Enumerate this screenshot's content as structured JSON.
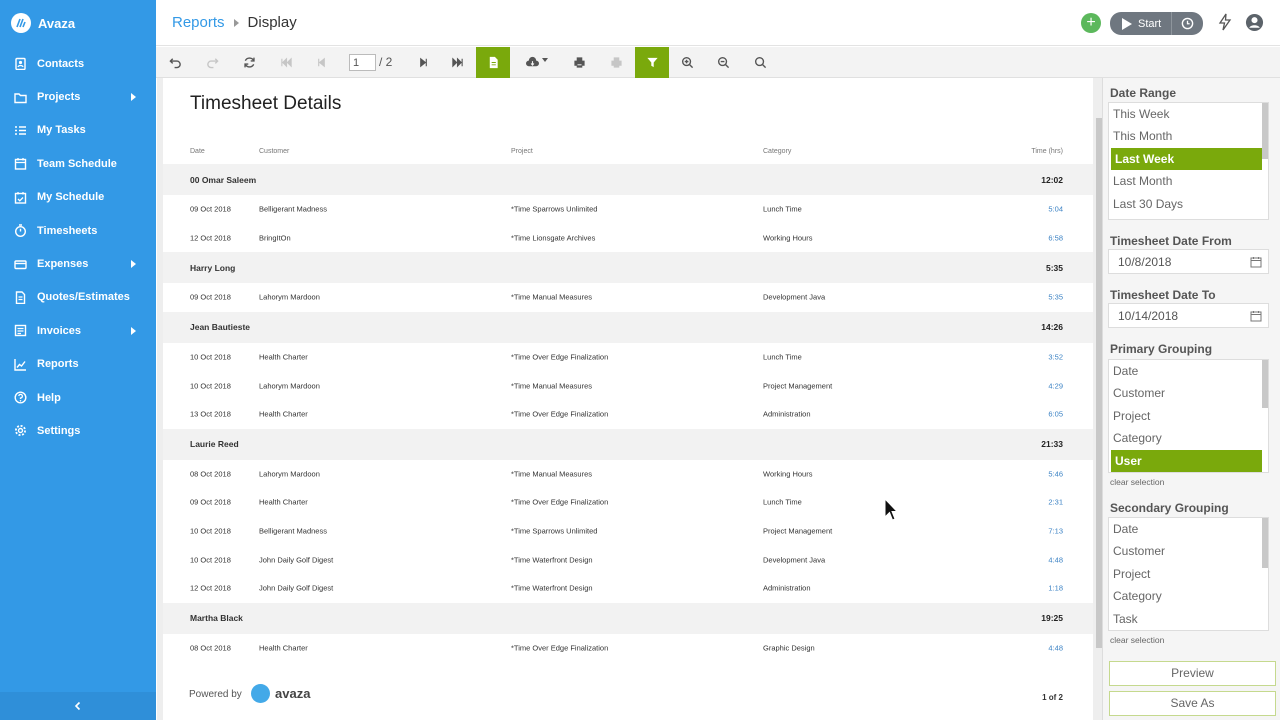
{
  "app": {
    "name": "Avaza"
  },
  "sidebar": {
    "items": [
      {
        "label": "Contacts",
        "icon": "contacts-icon",
        "submenu": false
      },
      {
        "label": "Projects",
        "icon": "folder-icon",
        "submenu": true
      },
      {
        "label": "My Tasks",
        "icon": "tasks-icon",
        "submenu": false
      },
      {
        "label": "Team Schedule",
        "icon": "calendar-icon",
        "submenu": false
      },
      {
        "label": "My Schedule",
        "icon": "calendar-check-icon",
        "submenu": false
      },
      {
        "label": "Timesheets",
        "icon": "stopwatch-icon",
        "submenu": false
      },
      {
        "label": "Expenses",
        "icon": "card-icon",
        "submenu": true
      },
      {
        "label": "Quotes/Estimates",
        "icon": "document-icon",
        "submenu": false
      },
      {
        "label": "Invoices",
        "icon": "invoice-icon",
        "submenu": true
      },
      {
        "label": "Reports",
        "icon": "chart-icon",
        "submenu": false
      },
      {
        "label": "Help",
        "icon": "help-icon",
        "submenu": false
      },
      {
        "label": "Settings",
        "icon": "gear-icon",
        "submenu": false
      }
    ]
  },
  "header": {
    "breadcrumb_parent": "Reports",
    "breadcrumb_current": "Display",
    "start_label": "Start",
    "add_label": "+"
  },
  "toolbar": {
    "page_current": "1",
    "page_total": "/ 2"
  },
  "report": {
    "title": "Timesheet Details",
    "columns": {
      "date": "Date",
      "customer": "Customer",
      "project": "Project",
      "category": "Category",
      "time": "Time (hrs)"
    },
    "groups": [
      {
        "name": "00 Omar Saleem",
        "total": "12:02",
        "rows": [
          {
            "date": "09 Oct 2018",
            "customer": "Belligerant Madness",
            "project": "*Time Sparrows Unlimited",
            "category": "Lunch Time",
            "time": "5:04"
          },
          {
            "date": "12 Oct 2018",
            "customer": "BringItOn",
            "project": "*Time Lionsgate Archives",
            "category": "Working Hours",
            "time": "6:58"
          }
        ]
      },
      {
        "name": "Harry Long",
        "total": "5:35",
        "rows": [
          {
            "date": "09 Oct 2018",
            "customer": "Lahorym Mardoon",
            "project": "*Time Manual Measures",
            "category": "Development Java",
            "time": "5:35"
          }
        ]
      },
      {
        "name": "Jean Bautieste",
        "total": "14:26",
        "rows": [
          {
            "date": "10 Oct 2018",
            "customer": "Health Charter",
            "project": "*Time Over Edge Finalization",
            "category": "Lunch Time",
            "time": "3:52"
          },
          {
            "date": "10 Oct 2018",
            "customer": "Lahorym Mardoon",
            "project": "*Time Manual Measures",
            "category": "Project Management",
            "time": "4:29"
          },
          {
            "date": "13 Oct 2018",
            "customer": "Health Charter",
            "project": "*Time Over Edge Finalization",
            "category": "Administration",
            "time": "6:05"
          }
        ]
      },
      {
        "name": "Laurie Reed",
        "total": "21:33",
        "rows": [
          {
            "date": "08 Oct 2018",
            "customer": "Lahorym Mardoon",
            "project": "*Time Manual Measures",
            "category": "Working Hours",
            "time": "5:46"
          },
          {
            "date": "09 Oct 2018",
            "customer": "Health Charter",
            "project": "*Time Over Edge Finalization",
            "category": "Lunch Time",
            "time": "2:31"
          },
          {
            "date": "10 Oct 2018",
            "customer": "Belligerant Madness",
            "project": "*Time Sparrows Unlimited",
            "category": "Project Management",
            "time": "7:13"
          },
          {
            "date": "10 Oct 2018",
            "customer": "John Daily Golf Digest",
            "project": "*Time Waterfront Design",
            "category": "Development Java",
            "time": "4:48"
          },
          {
            "date": "12 Oct 2018",
            "customer": "John Daily Golf Digest",
            "project": "*Time Waterfront Design",
            "category": "Administration",
            "time": "1:18"
          }
        ]
      },
      {
        "name": "Martha Black",
        "total": "19:25",
        "rows": [
          {
            "date": "08 Oct 2018",
            "customer": "Health Charter",
            "project": "*Time Over Edge Finalization",
            "category": "Graphic Design",
            "time": "4:48"
          }
        ]
      }
    ],
    "footer": {
      "powered_by": "Powered by",
      "logo_text": "avaza",
      "page_of": "1 of 2"
    }
  },
  "panel": {
    "date_range_label": "Date Range",
    "date_range_options": [
      "This Week",
      "This Month",
      "Last Week",
      "Last Month",
      "Last 30 Days"
    ],
    "date_range_selected": "Last Week",
    "date_from_label": "Timesheet Date From",
    "date_from_value": "10/8/2018",
    "date_to_label": "Timesheet Date To",
    "date_to_value": "10/14/2018",
    "primary_label": "Primary Grouping",
    "primary_options": [
      "Date",
      "Customer",
      "Project",
      "Category",
      "User"
    ],
    "primary_selected": "User",
    "clear_selection": "clear selection",
    "secondary_label": "Secondary Grouping",
    "secondary_options": [
      "Date",
      "Customer",
      "Project",
      "Category",
      "Task"
    ],
    "preview_label": "Preview",
    "save_as_label": "Save As"
  },
  "colors": {
    "sidebar": "#3399e6",
    "accent_green": "#7aa90c",
    "link_blue": "#3b82c4"
  }
}
